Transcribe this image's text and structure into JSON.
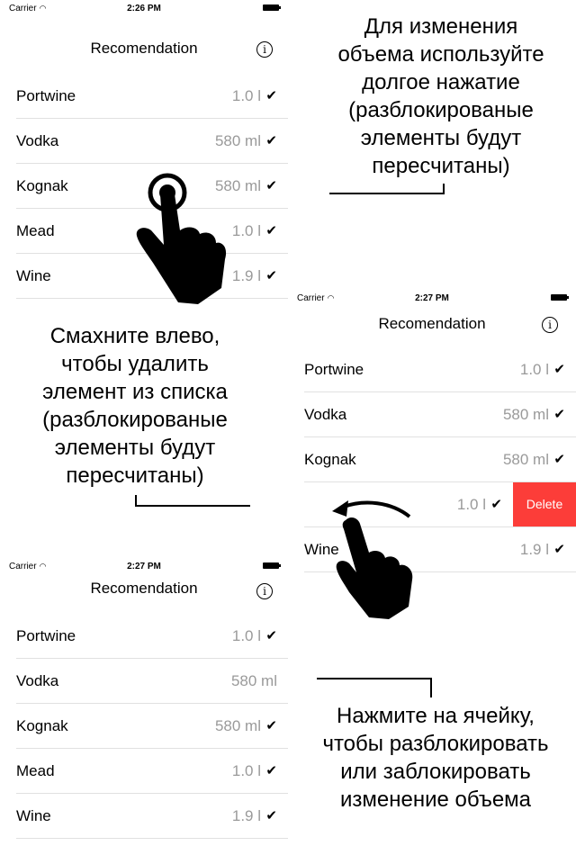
{
  "screens": [
    {
      "status": {
        "carrier": "Carrier",
        "time": "2:26 PM"
      },
      "title": "Recomendation",
      "info_glyph": "i",
      "rows": [
        {
          "name": "Portwine",
          "volume": "1.0 l",
          "check": "✔"
        },
        {
          "name": "Vodka",
          "volume": "580 ml",
          "check": "✔"
        },
        {
          "name": "Kognak",
          "volume": "580 ml",
          "check": "✔"
        },
        {
          "name": "Mead",
          "volume": "1.0 l",
          "check": "✔"
        },
        {
          "name": "Wine",
          "volume": "1.9 l",
          "check": "✔"
        }
      ]
    },
    {
      "status": {
        "carrier": "Carrier",
        "time": "2:27 PM"
      },
      "title": "Recomendation",
      "info_glyph": "i",
      "rows": [
        {
          "name": "Portwine",
          "volume": "1.0 l",
          "check": "✔"
        },
        {
          "name": "Vodka",
          "volume": "580 ml",
          "check": "✔"
        },
        {
          "name": "Kognak",
          "volume": "580 ml",
          "check": "✔"
        },
        {
          "name": "",
          "volume": "1.0 l",
          "check": "✔",
          "delete_label": "Delete"
        },
        {
          "name": "Wine",
          "volume": "1.9 l",
          "check": "✔"
        }
      ]
    },
    {
      "status": {
        "carrier": "Carrier",
        "time": "2:27 PM"
      },
      "title": "Recomendation",
      "info_glyph": "i",
      "rows": [
        {
          "name": "Portwine",
          "volume": "1.0 l",
          "check": "✔"
        },
        {
          "name": "Vodka",
          "volume": "580 ml",
          "check": ""
        },
        {
          "name": "Kognak",
          "volume": "580 ml",
          "check": "✔"
        },
        {
          "name": "Mead",
          "volume": "1.0 l",
          "check": "✔"
        },
        {
          "name": "Wine",
          "volume": "1.9 l",
          "check": "✔"
        }
      ]
    }
  ],
  "callouts": {
    "long_press": [
      "Для изменения",
      "объема используйте",
      "долгое нажатие",
      "(разблокированые",
      "элементы будут",
      "пересчитаны)"
    ],
    "swipe_left": [
      "Смахните влево,",
      "чтобы удалить",
      "элемент из списка",
      "(разблокированые",
      "элементы будут",
      "пересчитаны)"
    ],
    "tap": [
      "Нажмите на ячейку,",
      "чтобы разблокировать",
      "или заблокировать",
      "изменение объема"
    ]
  },
  "icons": {
    "wifi": "wifi-icon",
    "battery": "battery-icon",
    "info": "info-icon",
    "check": "checkmark-icon",
    "hand": "hand-pointer-icon"
  },
  "colors": {
    "delete": "#fc3d39",
    "volume_text": "#9a9a9a",
    "separator": "#e1e1e1"
  }
}
